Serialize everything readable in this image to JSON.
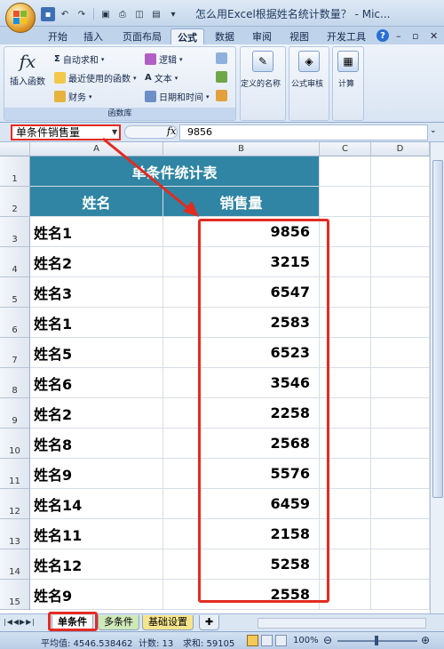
{
  "window": {
    "title": "怎么用Excel根据姓名统计数量？ - Mic...",
    "minimize": "–",
    "restore": "▫",
    "close": "✕"
  },
  "ribbon_tabs": [
    "开始",
    "插入",
    "页面布局",
    "公式",
    "数据",
    "审阅",
    "视图",
    "开发工具"
  ],
  "active_tab": "公式",
  "help": "?",
  "ribbon": {
    "insert_function": "插入函数",
    "fx_glyph": "fx",
    "autosum": "自动求和",
    "recent": "最近使用的函数",
    "financial": "财务",
    "logical": "逻辑",
    "text": "文本",
    "datetime": "日期和时间",
    "group_label": "函数库",
    "defined_names": "定义的名称",
    "formula_audit": "公式审核",
    "calculation": "计算"
  },
  "formula_bar": {
    "name_box": "单条件销售量",
    "fx": "fx",
    "value": "9856"
  },
  "columns": [
    "A",
    "B",
    "C",
    "D"
  ],
  "table": {
    "title": "单条件统计表",
    "header_name": "姓名",
    "header_sales": "销售量",
    "rows": [
      {
        "name": "姓名1",
        "value": "9856"
      },
      {
        "name": "姓名2",
        "value": "3215"
      },
      {
        "name": "姓名3",
        "value": "6547"
      },
      {
        "name": "姓名1",
        "value": "2583"
      },
      {
        "name": "姓名5",
        "value": "6523"
      },
      {
        "name": "姓名6",
        "value": "3546"
      },
      {
        "name": "姓名2",
        "value": "2258"
      },
      {
        "name": "姓名8",
        "value": "2568"
      },
      {
        "name": "姓名9",
        "value": "5576"
      },
      {
        "name": "姓名14",
        "value": "6459"
      },
      {
        "name": "姓名11",
        "value": "2158"
      },
      {
        "name": "姓名12",
        "value": "5258"
      },
      {
        "name": "姓名9",
        "value": "2558"
      }
    ]
  },
  "row_numbers": [
    "1",
    "2",
    "3",
    "4",
    "5",
    "6",
    "7",
    "8",
    "9",
    "10",
    "11",
    "12",
    "13",
    "14",
    "15"
  ],
  "sheet_tabs": [
    "单条件",
    "多条件",
    "基础设置"
  ],
  "status": {
    "average": "平均值: 4546.538462",
    "count": "计数: 13",
    "sum": "求和: 59105",
    "zoom": "100%"
  },
  "colors": {
    "header_fill": "#2f85a3",
    "highlight": "#e32b22"
  }
}
